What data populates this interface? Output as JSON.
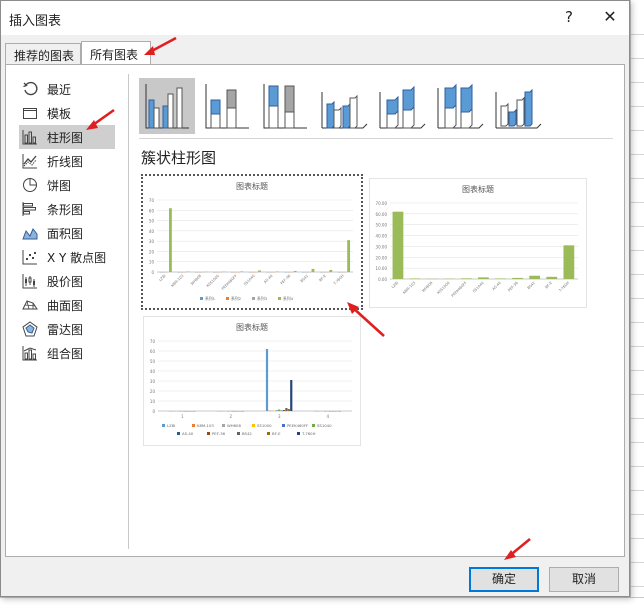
{
  "dialog": {
    "title": "插入图表",
    "help": "?",
    "close": "✕"
  },
  "tabs": [
    {
      "label": "推荐的图表"
    },
    {
      "label": "所有图表"
    }
  ],
  "sidebar": {
    "items": [
      {
        "label": "最近",
        "icon": "recent-icon"
      },
      {
        "label": "模板",
        "icon": "folder-icon"
      },
      {
        "label": "柱形图",
        "icon": "column-chart-icon",
        "selected": true
      },
      {
        "label": "折线图",
        "icon": "line-chart-icon"
      },
      {
        "label": "饼图",
        "icon": "pie-chart-icon"
      },
      {
        "label": "条形图",
        "icon": "bar-chart-icon"
      },
      {
        "label": "面积图",
        "icon": "area-chart-icon"
      },
      {
        "label": "X Y 散点图",
        "icon": "scatter-chart-icon"
      },
      {
        "label": "股价图",
        "icon": "stock-chart-icon"
      },
      {
        "label": "曲面图",
        "icon": "surface-chart-icon"
      },
      {
        "label": "雷达图",
        "icon": "radar-chart-icon"
      },
      {
        "label": "组合图",
        "icon": "combo-chart-icon"
      }
    ]
  },
  "main": {
    "subtypes": [
      {
        "icon": "clustered-column-icon",
        "selected": true
      },
      {
        "icon": "stacked-column-icon"
      },
      {
        "icon": "100-stacked-column-icon"
      },
      {
        "icon": "3d-clustered-column-icon"
      },
      {
        "icon": "3d-stacked-column-icon"
      },
      {
        "icon": "3d-100-stacked-column-icon"
      },
      {
        "icon": "3d-column-icon"
      }
    ],
    "variant_title": "簇状柱形图"
  },
  "chart_data": [
    {
      "type": "bar",
      "title": "图表标题",
      "categories": [
        "LZ8I",
        "K8M-103",
        "WH608",
        "KSS1000",
        "PEEK460FF",
        "SS1040",
        "AS-40",
        "PEF-36",
        "BS42",
        "BF-E",
        "T-760H"
      ],
      "series": [
        {
          "name": "系列1",
          "values": [
            0,
            0,
            0,
            0,
            0,
            0,
            0,
            0,
            0,
            0,
            0
          ]
        },
        {
          "name": "系列2",
          "values": [
            0,
            0,
            0,
            0,
            0,
            0,
            0,
            0,
            0,
            0,
            0
          ]
        },
        {
          "name": "系列3",
          "values": [
            0,
            0,
            0,
            0,
            0,
            0,
            0,
            0,
            0,
            0,
            0
          ]
        },
        {
          "name": "系列4",
          "values": [
            62,
            0.5,
            0.2,
            0.3,
            0.6,
            1.5,
            0.5,
            1,
            3,
            2,
            31
          ]
        }
      ],
      "ylim": [
        0,
        70
      ],
      "yticks": [
        "0",
        "10",
        "20",
        "30",
        "40",
        "50",
        "60",
        "70"
      ],
      "legend": "bottom",
      "grid": true,
      "colors": [
        "#5b9bd5",
        "#ed7d31",
        "#a5a5a5",
        "#9bbb59"
      ]
    },
    {
      "type": "bar",
      "title": "图表标题",
      "categories": [
        "LZ8I",
        "K8M-103",
        "WH608",
        "KSS1000",
        "PEEK460FF",
        "SS1040",
        "AS-40",
        "PEF-36",
        "BS42",
        "BF-E",
        "T-760H"
      ],
      "series": [
        {
          "values": [
            62,
            0.5,
            0.2,
            0.3,
            0.6,
            1.5,
            0.5,
            1,
            3,
            2,
            31
          ]
        }
      ],
      "ylim": [
        0,
        70
      ],
      "yticks": [
        "0.00",
        "10.00",
        "20.00",
        "30.00",
        "40.00",
        "50.00",
        "60.00",
        "70.00"
      ],
      "legend": "none",
      "grid": true,
      "colors": [
        "#9bbb59"
      ]
    },
    {
      "type": "bar",
      "title": "图表标题",
      "categories": [
        "1",
        "2",
        "3",
        "4"
      ],
      "series": [
        {
          "name": "LZ8I",
          "values": [
            0,
            0,
            62,
            0
          ]
        },
        {
          "name": "K8M-103",
          "values": [
            0,
            0,
            0.5,
            0
          ]
        },
        {
          "name": "WH608",
          "values": [
            0,
            0,
            0.3,
            0
          ]
        },
        {
          "name": "SS1000",
          "values": [
            0,
            0,
            0.4,
            0
          ]
        },
        {
          "name": "PEEK460FF",
          "values": [
            0,
            0,
            0.6,
            0
          ]
        },
        {
          "name": "SS1040",
          "values": [
            0,
            0,
            1.5,
            0
          ]
        },
        {
          "name": "AS-40",
          "values": [
            0,
            0,
            0.5,
            0
          ]
        },
        {
          "name": "PEF-36",
          "values": [
            0,
            0,
            1,
            0
          ]
        },
        {
          "name": "BS42",
          "values": [
            0,
            0,
            3,
            0
          ]
        },
        {
          "name": "BF-E",
          "values": [
            0,
            0,
            2,
            0
          ]
        },
        {
          "name": "T-760H",
          "values": [
            0,
            0,
            31,
            0
          ]
        }
      ],
      "ylim": [
        0,
        70
      ],
      "yticks": [
        "0",
        "10",
        "20",
        "30",
        "40",
        "50",
        "60",
        "70"
      ],
      "legend": "bottom",
      "grid": true,
      "colors": [
        "#5b9bd5",
        "#ed7d31",
        "#a5a5a5",
        "#ffc000",
        "#4472c4",
        "#70ad47",
        "#255e91",
        "#9e480e",
        "#636363",
        "#997300",
        "#264478"
      ]
    }
  ],
  "buttons": {
    "ok": "确定",
    "cancel": "取消"
  }
}
